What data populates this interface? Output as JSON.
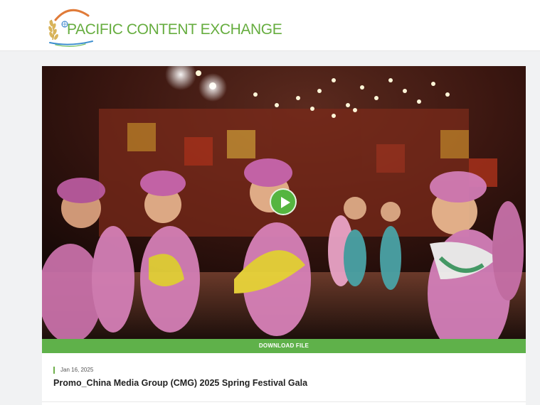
{
  "header": {
    "logo_text": "PACIFIC CONTENT EXCHANGE"
  },
  "video": {
    "download_label": "DOWNLOAD FILE",
    "date": "Jan 16, 2025",
    "title": "Promo_China Media Group (CMG) 2025 Spring Festival Gala"
  },
  "colors": {
    "brand_green": "#66ad3f",
    "download_bar": "#5fb14a",
    "play_button": "#55b540",
    "logo_orange": "#e07b39"
  }
}
